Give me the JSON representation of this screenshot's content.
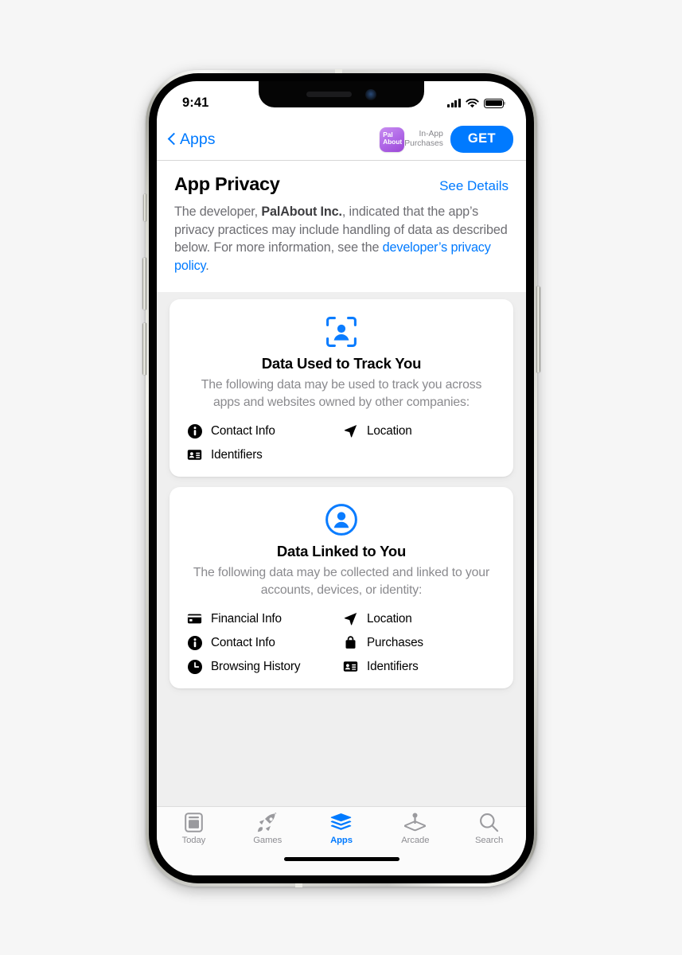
{
  "status_bar": {
    "time": "9:41",
    "signal_icon": "cellular-signal-icon",
    "wifi_icon": "wifi-icon",
    "battery_icon": "battery-full-icon"
  },
  "nav_bar": {
    "back_label": "Apps",
    "back_icon": "chevron-left-icon",
    "app_icon_text": "Pal\nAbout",
    "app_icon_name": "palabout-app-icon",
    "in_app_purchases_label": "In-App\nPurchases",
    "get_label": "GET",
    "accent_color": "#007aff",
    "app_icon_color": "#b16ae8"
  },
  "privacy_header": {
    "title": "App Privacy",
    "see_details_label": "See Details",
    "body_prefix": "The developer, ",
    "developer_name": "PalAbout Inc.",
    "body_middle": ", indicated that the app’s privacy practices may include handling of data as described below. For more information, see the ",
    "policy_link": "developer’s privacy policy",
    "body_suffix": "."
  },
  "cards": [
    {
      "icon_name": "person-viewfinder-icon",
      "title": "Data Used to Track You",
      "description": "The following data may be used to track you across apps and websites owned by other companies:",
      "items": [
        {
          "label": "Contact Info",
          "icon": "info-circle-icon"
        },
        {
          "label": "Location",
          "icon": "location-arrow-icon"
        },
        {
          "label": "Identifiers",
          "icon": "id-card-icon"
        }
      ]
    },
    {
      "icon_name": "person-circle-icon",
      "title": "Data Linked to You",
      "description": "The following data may be collected and linked to your accounts, devices, or identity:",
      "items": [
        {
          "label": "Financial Info",
          "icon": "credit-card-icon"
        },
        {
          "label": "Location",
          "icon": "location-arrow-icon"
        },
        {
          "label": "Contact Info",
          "icon": "info-circle-icon"
        },
        {
          "label": "Purchases",
          "icon": "shopping-bag-icon"
        },
        {
          "label": "Browsing History",
          "icon": "clock-icon"
        },
        {
          "label": "Identifiers",
          "icon": "id-card-icon"
        }
      ]
    }
  ],
  "tab_bar": {
    "active_index": 2,
    "tabs": [
      {
        "label": "Today",
        "icon": "today-card-icon"
      },
      {
        "label": "Games",
        "icon": "rocket-icon"
      },
      {
        "label": "Apps",
        "icon": "layers-stack-icon"
      },
      {
        "label": "Arcade",
        "icon": "joystick-icon"
      },
      {
        "label": "Search",
        "icon": "magnifier-icon"
      }
    ]
  }
}
